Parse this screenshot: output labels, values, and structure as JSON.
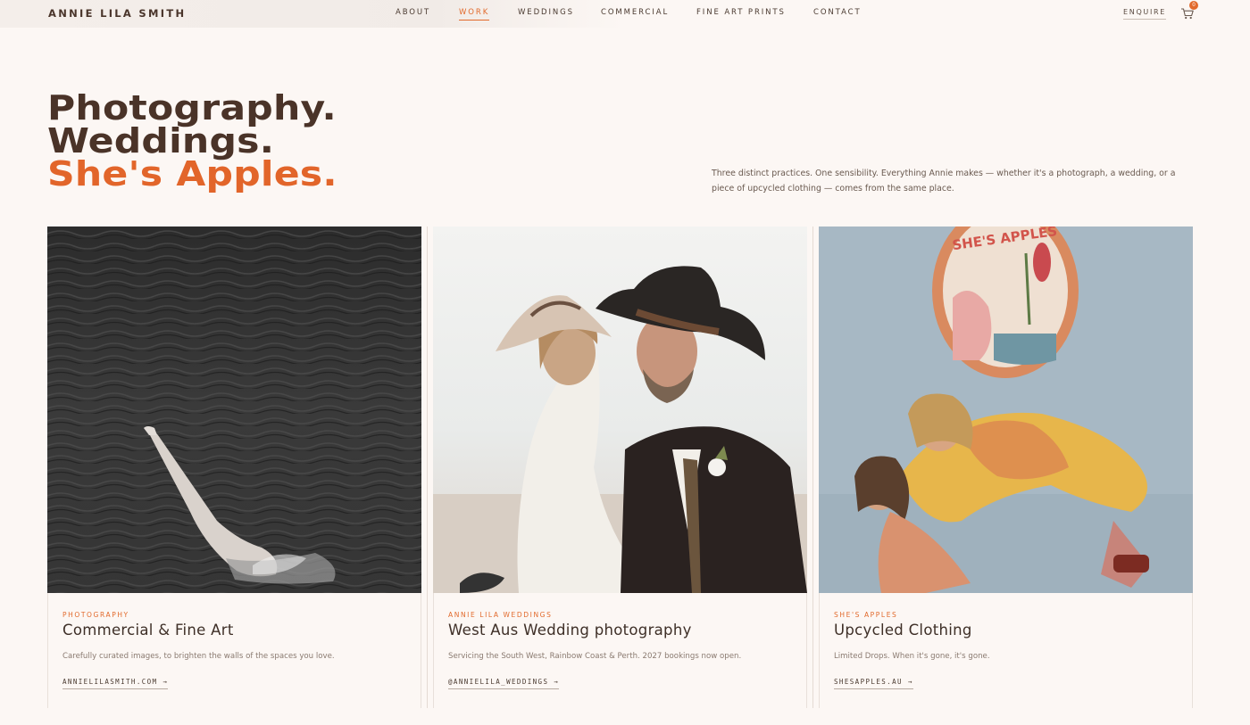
{
  "header": {
    "logo": "ANNIE LILA SMITH",
    "nav": [
      {
        "label": "ABOUT",
        "active": false
      },
      {
        "label": "WORK",
        "active": true
      },
      {
        "label": "WEDDINGS",
        "active": false
      },
      {
        "label": "COMMERCIAL",
        "active": false
      },
      {
        "label": "FINE ART PRINTS",
        "active": false
      },
      {
        "label": "CONTACT",
        "active": false
      }
    ],
    "enquire": "ENQUIRE",
    "cart_icon": "cart-icon",
    "cart_count": "0"
  },
  "hero": {
    "line1": "Photography.",
    "line2": "Weddings.",
    "line3": "She's Apples.",
    "intro": "Three distinct practices. One sensibility. Everything Annie makes — whether it's a photograph, a wedding, or a piece of upcycled clothing — comes from the same place."
  },
  "cards": [
    {
      "eyebrow": "PHOTOGRAPHY",
      "title": "Commercial & Fine Art",
      "description": "Carefully curated images, to brighten the walls of the spaces you love.",
      "link": "ANNIELILASMITH.COM →"
    },
    {
      "eyebrow": "ANNIE LILA WEDDINGS",
      "title": "West Aus Wedding photography",
      "description": "Servicing the South West, Rainbow Coast & Perth. 2027 bookings now open.",
      "link": "@ANNIELILA_WEDDINGS →"
    },
    {
      "eyebrow": "SHE'S APPLES",
      "title": "Upcycled Clothing",
      "description": "Limited Drops.  When it's gone, it's gone.",
      "link": "SHESAPPLES.AU →",
      "sign_text": "SHE'S APPLES"
    }
  ],
  "colors": {
    "background": "#fcf7f4",
    "accent": "#e26a2c",
    "heading": "#4a3328"
  }
}
